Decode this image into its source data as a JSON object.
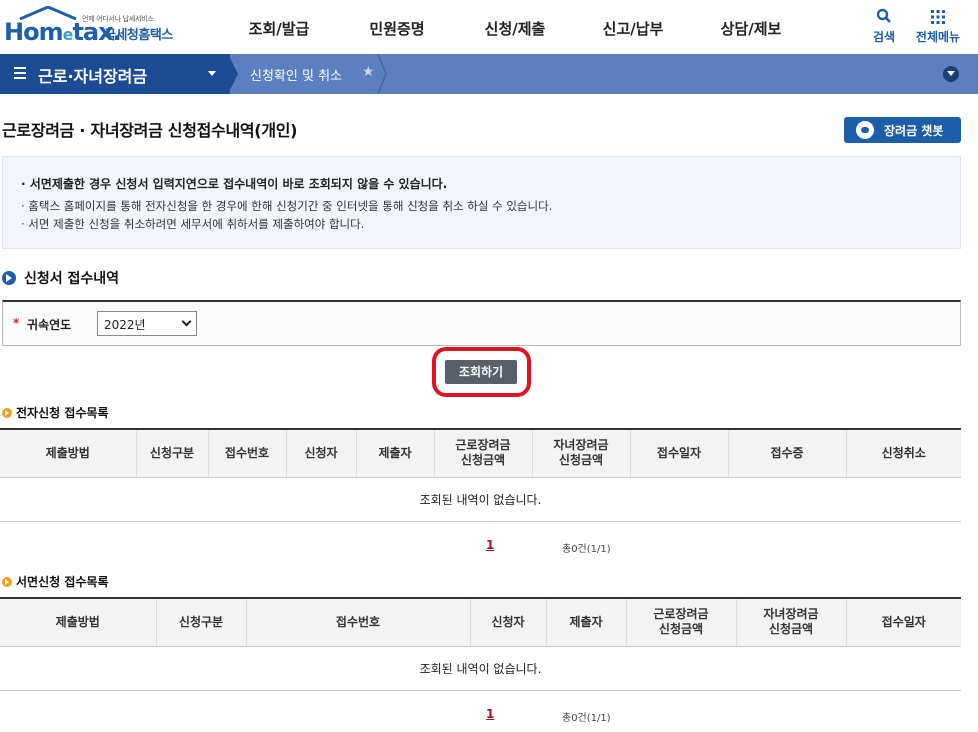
{
  "header": {
    "logo_small": "언제 어디서나 납세서비스",
    "logo_main_a": "Hom",
    "logo_main_e": "e",
    "logo_main_b": "tax.",
    "logo_kr": "국세청홈택스",
    "gnb": [
      "조회/발급",
      "민원증명",
      "신청/제출",
      "신고/납부",
      "상담/제보"
    ],
    "search_label": "검색",
    "allmenu_label": "전체메뉴"
  },
  "nav": {
    "menu_title": "근로·자녀장려금",
    "sub_title": "신청확인 및 취소"
  },
  "page": {
    "title": "근로장려금 · 자녀장려금 신청접수내역(개인)",
    "chatbot_label": "장려금 챗봇"
  },
  "notice": {
    "line1": "· 서면제출한 경우 신청서 입력지연으로 접수내역이 바로 조회되지 않을 수 있습니다.",
    "line2": "· 홈택스 홈페이지를 통해 전자신청을 한 경우에 한해 신청기간 중 인터넷을 통해 신청을 취소 하실 수 있습니다.",
    "line3": "· 서면 제출한 신청을 취소하려면 세무서에 취하서를 제출하여야 합니다."
  },
  "section": {
    "title": "신청서 접수내역",
    "year_label": "귀속연도",
    "year_required": "*",
    "year_value": "2022년",
    "query_label": "조회하기"
  },
  "electronic": {
    "title": "전자신청 접수목록",
    "headers": [
      "제출방법",
      "신청구분",
      "접수번호",
      "신청자",
      "제출자",
      "근로장려금\n신청금액",
      "자녀장려금\n신청금액",
      "접수일자",
      "접수증",
      "신청취소"
    ],
    "empty": "조회된 내역이 없습니다.",
    "page": "1",
    "total": "총0건(1/1)"
  },
  "paper": {
    "title": "서면신청 접수목록",
    "headers": [
      "제출방법",
      "신청구분",
      "접수번호",
      "신청자",
      "제출자",
      "근로장려금\n신청금액",
      "자녀장려금\n신청금액",
      "접수일자"
    ],
    "empty": "조회된 내역이 없습니다.",
    "page": "1",
    "total": "총0건(1/1)"
  },
  "colors": {
    "brand_blue": "#1f5ea8",
    "nav_dark": "#1c4c94",
    "nav_light": "#5b7fbf",
    "highlight_red": "#e0121f"
  }
}
